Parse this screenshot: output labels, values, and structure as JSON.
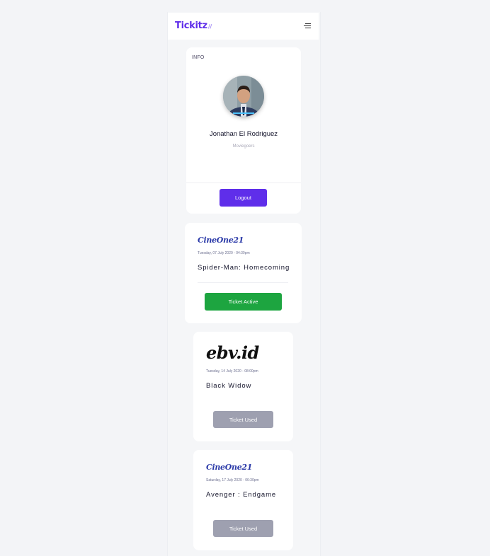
{
  "navbar": {
    "brand": "Tickitz",
    "brand_mark": "//"
  },
  "profile": {
    "section_title": "INFO",
    "name": "Jonathan El Rodriguez",
    "role": "Moviegoers",
    "logout_label": "Logout"
  },
  "tickets": [
    {
      "cinema": "CineOne21",
      "date": "Tuesday, 07 July 2020 - 04:30pm",
      "movie": "Spider-Man: Homecoming",
      "status": "Ticket Active"
    },
    {
      "cinema": "ebv.id",
      "date": "Tuesday, 14 July 2020 - 08:00pm",
      "movie": "Black Widow",
      "status": "Ticket Used"
    },
    {
      "cinema": "CineOne21",
      "date": "Saturday, 17 July 2020 - 06:30pm",
      "movie": "Avenger : Endgame",
      "status": "Ticket Used"
    }
  ],
  "colors": {
    "brand": "#5f2eea",
    "active": "#1da540",
    "used": "#9ea0b0",
    "cineone": "#2b3aa8"
  },
  "icons": {
    "menu": "hamburger-menu-icon",
    "avatar": "user-avatar"
  }
}
